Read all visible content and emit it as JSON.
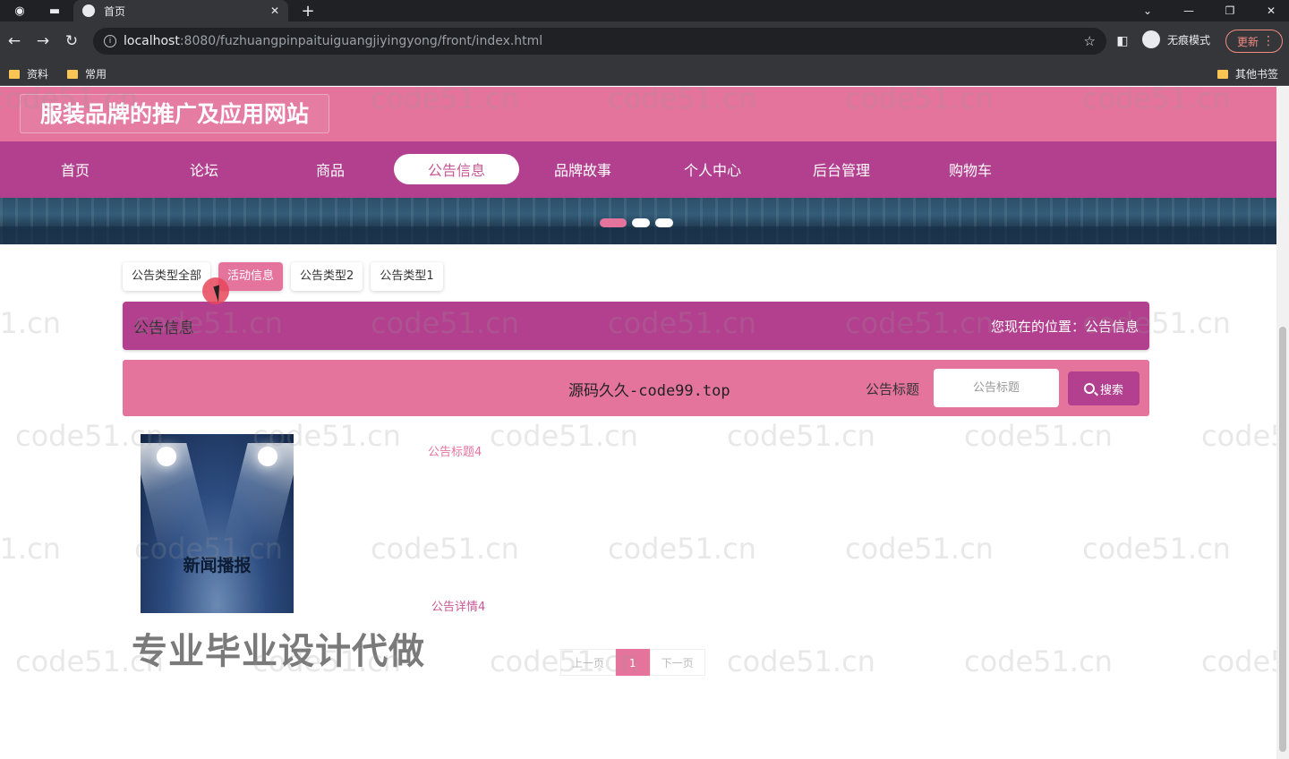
{
  "browser": {
    "tab_title": "首页",
    "url_host": "localhost",
    "url_path": ":8080/fuzhuangpinpaituiguangjiyingyong/front/index.html",
    "profile_label": "无痕模式",
    "update_label": "更新",
    "bookmarks": [
      "资料",
      "常用"
    ],
    "other_bookmarks": "其他书签"
  },
  "site": {
    "title": "服装品牌的推广及应用网站"
  },
  "nav": {
    "items": [
      "首页",
      "论坛",
      "商品",
      "公告信息",
      "品牌故事",
      "个人中心",
      "后台管理",
      "购物车"
    ],
    "active_index": 3
  },
  "type_tabs": {
    "items": [
      "公告类型全部",
      "活动信息",
      "公告类型2",
      "公告类型1"
    ],
    "active_index": 1
  },
  "title_bar": {
    "title": "公告信息",
    "breadcrumb": "您现在的位置：公告信息"
  },
  "search": {
    "source_text": "源码久久-code99.top",
    "label": "公告标题",
    "placeholder": "公告标题",
    "button_label": "搜索"
  },
  "news": {
    "image_text": "新闻播报",
    "title": "公告标题4",
    "detail": "公告详情4"
  },
  "promo_text": "专业毕业设计代做",
  "pagination": {
    "prev": "上一页",
    "current": "1",
    "next": "下一页"
  },
  "watermark": "code51.cn",
  "colors": {
    "header_pink": "#e4749c",
    "nav_purple": "#b3408f",
    "accent": "#c65995"
  }
}
